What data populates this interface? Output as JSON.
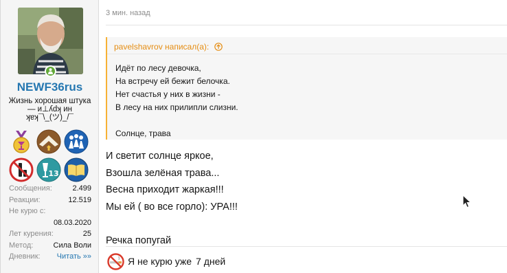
{
  "user": {
    "username": "NEWF36rus",
    "title": "Жизнь хорошая штука — и⊥ʎdʞ ин ʞɐʞ¯\\_(ツ)_/¯",
    "online": true,
    "stats": [
      {
        "label": "Сообщения:",
        "value": "2.499"
      },
      {
        "label": "Реакции:",
        "value": "12.519"
      },
      {
        "label": "Не курю с:",
        "value": ""
      },
      {
        "label": "",
        "value": "08.03.2020"
      },
      {
        "label": "Лет курения:",
        "value": "25"
      },
      {
        "label": "Метод:",
        "value": "Сила Воли"
      },
      {
        "label": "Дневник:",
        "value": "Читать »»"
      }
    ],
    "trophies": [
      "medal-trophy",
      "rank-chevron-trophy",
      "people-group-trophy",
      "no-alcohol-trophy",
      "glass-13-trophy",
      "book-trophy"
    ]
  },
  "message": {
    "date": "3 мин. назад",
    "quote": {
      "author_line": "pavelshavrov написал(а):",
      "lines": [
        "Идёт по лесу девочка,",
        "На встречу ей бежит белочка.",
        "Нет счастья у них в жизни -",
        "В лесу на них прилипли слизни.",
        "",
        "Солнце, трава"
      ]
    },
    "lines": [
      "И светит солнце яркое,",
      "Взошла зелёная трава...",
      "Весна приходит жаркая!!!",
      "Мы ей ( во все горло): УРА!!!",
      "",
      "Речка попугай"
    ],
    "signature": {
      "label": "Я не курю уже",
      "value": "7 дней"
    }
  },
  "colors": {
    "link": "#2577b1",
    "quote_accent": "#f7b135",
    "quote_author": "#e58d13",
    "online": "#62a838"
  }
}
